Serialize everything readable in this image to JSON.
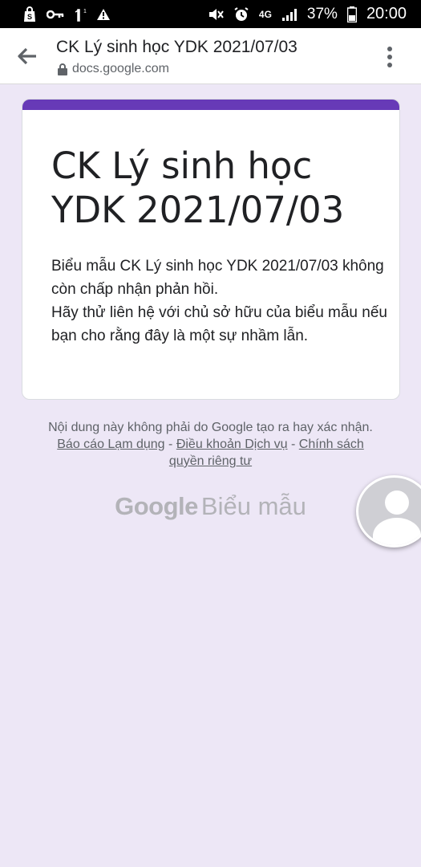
{
  "status_bar": {
    "signal_label": "4G",
    "battery_percent": "37%",
    "time": "20:00",
    "icons_left": [
      "shopping-bag-icon",
      "key-icon",
      "sim-icon",
      "warning-icon"
    ],
    "icons_right": [
      "mute-icon",
      "alarm-icon",
      "signal-icon",
      "battery-icon"
    ]
  },
  "browser_bar": {
    "title": "CK Lý sinh học YDK 2021/07/03",
    "domain": "docs.google.com"
  },
  "form_card": {
    "accent_color": "#673ab7",
    "title": "CK Lý sinh học YDK 2021/07/03",
    "message_line1": "Biểu mẫu CK Lý sinh học YDK 2021/07/03 không còn chấp nhận phản hồi.",
    "message_line2": "Hãy thử liên hệ với chủ sở hữu của biểu mẫu nếu bạn cho rằng đây là một sự nhầm lẫn."
  },
  "footer": {
    "note_text": "Nội dung này không phải do Google tạo ra hay xác nhận.",
    "report_abuse_link": "Báo cáo Lạm dụng",
    "separator": "-",
    "terms_link": "Điều khoản Dịch vụ",
    "privacy_link": "Chính sách quyền riêng tư"
  },
  "brand": {
    "google": "Google",
    "product": "Biểu mẫu"
  },
  "overlay": {
    "avatar_icon": "avatar-icon"
  }
}
